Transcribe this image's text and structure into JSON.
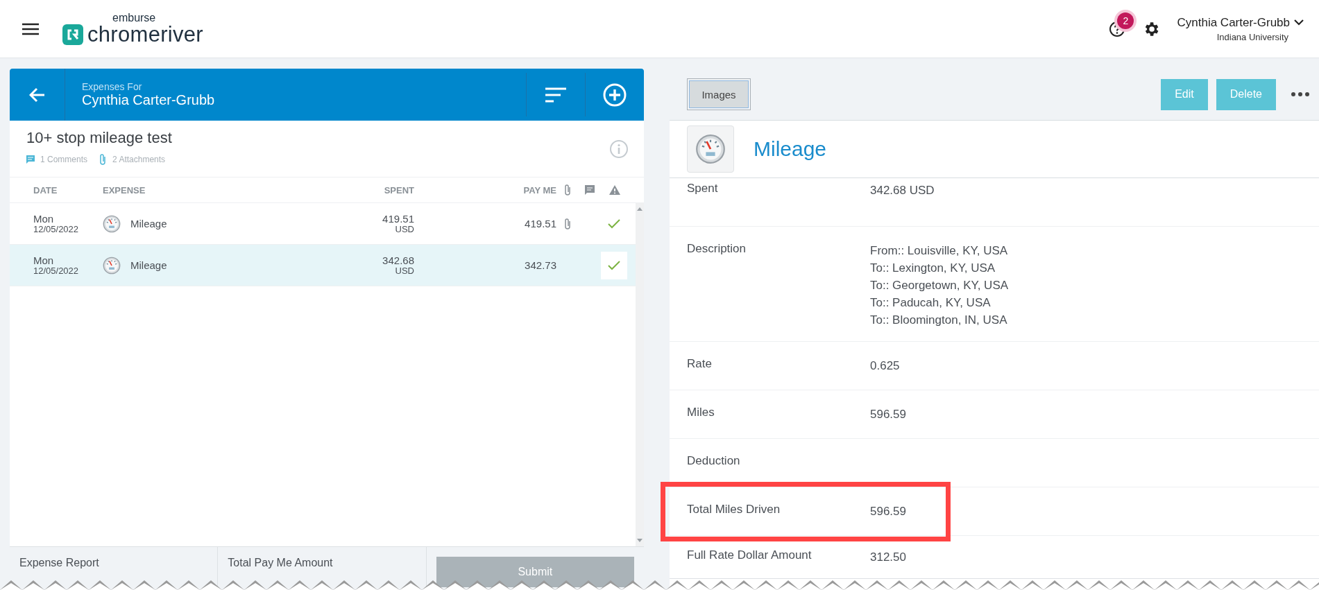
{
  "header": {
    "logo_top": "emburse",
    "logo_main": "chromeriver",
    "help_badge": "2",
    "user_name": "Cynthia Carter-Grubb",
    "user_org": "Indiana University"
  },
  "report": {
    "caption": "Expenses For",
    "owner": "Cynthia Carter-Grubb",
    "title": "10+ stop mileage test",
    "comments": "1 Comments",
    "attachments": "2 Attachments",
    "columns": [
      "DATE",
      "EXPENSE",
      "SPENT",
      "PAY ME"
    ],
    "rows": [
      {
        "day": "Mon",
        "date": "12/05/2022",
        "expense": "Mileage",
        "spent": "419.51",
        "currency": "USD",
        "pay_me": "419.51",
        "has_attachment": true,
        "selected": false
      },
      {
        "day": "Mon",
        "date": "12/05/2022",
        "expense": "Mileage",
        "spent": "342.68",
        "currency": "USD",
        "pay_me": "342.73",
        "has_attachment": false,
        "selected": true
      }
    ],
    "footer": {
      "report_label": "Expense Report",
      "total_label": "Total Pay Me Amount",
      "submit": "Submit",
      "submit_disabled": true
    }
  },
  "detail": {
    "images_button": "Images",
    "edit_button": "Edit",
    "delete_button": "Delete",
    "title": "Mileage",
    "fields": [
      {
        "label": "Spent",
        "value": [
          "342.68 USD"
        ],
        "highlighted": false
      },
      {
        "label": "Description",
        "value": [
          "From:: Louisville, KY, USA",
          "To:: Lexington, KY, USA",
          "To:: Georgetown, KY, USA",
          "To:: Paducah, KY, USA",
          "To:: Bloomington, IN, USA"
        ],
        "highlighted": false
      },
      {
        "label": "Rate",
        "value": [
          "0.625"
        ],
        "highlighted": false
      },
      {
        "label": "Miles",
        "value": [
          "596.59"
        ],
        "highlighted": false
      },
      {
        "label": "Deduction",
        "highlighted": false
      },
      {
        "label": "Total Miles Driven",
        "value": [
          "596.59"
        ],
        "highlighted": true
      },
      {
        "label": "Full Rate Dollar Amount",
        "value": [
          "312.50"
        ],
        "highlighted": false
      }
    ]
  }
}
